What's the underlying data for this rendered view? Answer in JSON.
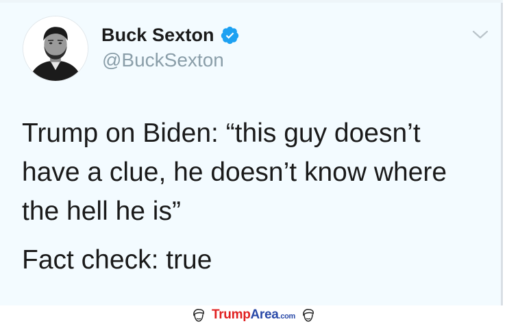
{
  "tweet": {
    "author": {
      "display_name": "Buck Sexton",
      "handle": "@BuckSexton",
      "verified": true,
      "avatar_icon": "profile-photo",
      "verified_icon": "verified-badge-icon",
      "verified_color": "#1da1f2"
    },
    "menu_icon": "chevron-down-icon",
    "text_lines": [
      "Trump on Biden: “this guy doesn’t",
      "have a clue, he doesn’t know where",
      "the hell he is”"
    ],
    "text_tail": "Fact check: true",
    "background_color": "#f3fbff"
  },
  "watermark": {
    "brand_part1": "Trump",
    "brand_part2": "Area",
    "brand_suffix": ".com",
    "icon": "trump-head-icon",
    "brand_color_1": "#e02020",
    "brand_color_2": "#2a4aa8"
  }
}
